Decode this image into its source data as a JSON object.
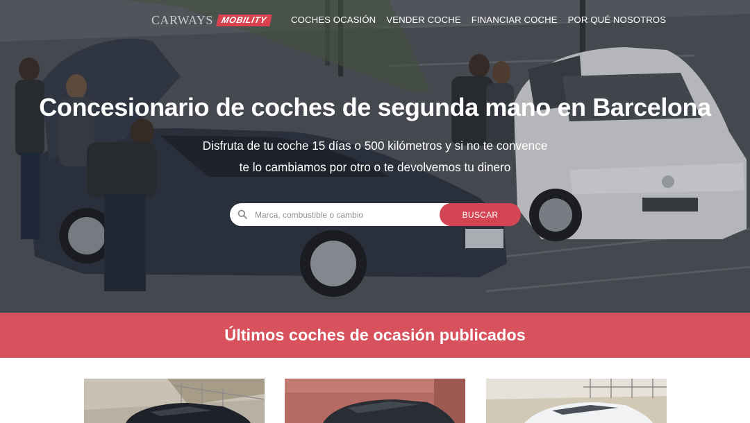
{
  "nav": {
    "logo_word": "CARWAYS",
    "logo_badge": "MOBILITY",
    "links": [
      "COCHES OCASIÓN",
      "VENDER COCHE",
      "FINANCIAR COCHE",
      "POR QUÉ NOSOTROS"
    ]
  },
  "hero": {
    "title": "Concesionario de coches de segunda mano en Barcelona",
    "subtitle_line1": "Disfruta de tu coche 15 días o 500 kilómetros y si no te convence",
    "subtitle_line2": "te lo cambiamos por otro o te devolvemos tu dinero"
  },
  "search": {
    "placeholder": "Marca, combustible o cambio",
    "value": "",
    "button_label": "BUSCAR",
    "icon": "search-icon"
  },
  "band": {
    "title": "Últimos coches de ocasión publicados"
  },
  "colors": {
    "brand_red": "#d8525d",
    "button_red": "#d34552",
    "text_light": "#ffffff"
  },
  "cards": [
    {
      "name": "car-card-1",
      "image": "black-hatchback-photo"
    },
    {
      "name": "car-card-2",
      "image": "dark-suv-photo"
    },
    {
      "name": "car-card-3",
      "image": "white-car-photo"
    }
  ]
}
